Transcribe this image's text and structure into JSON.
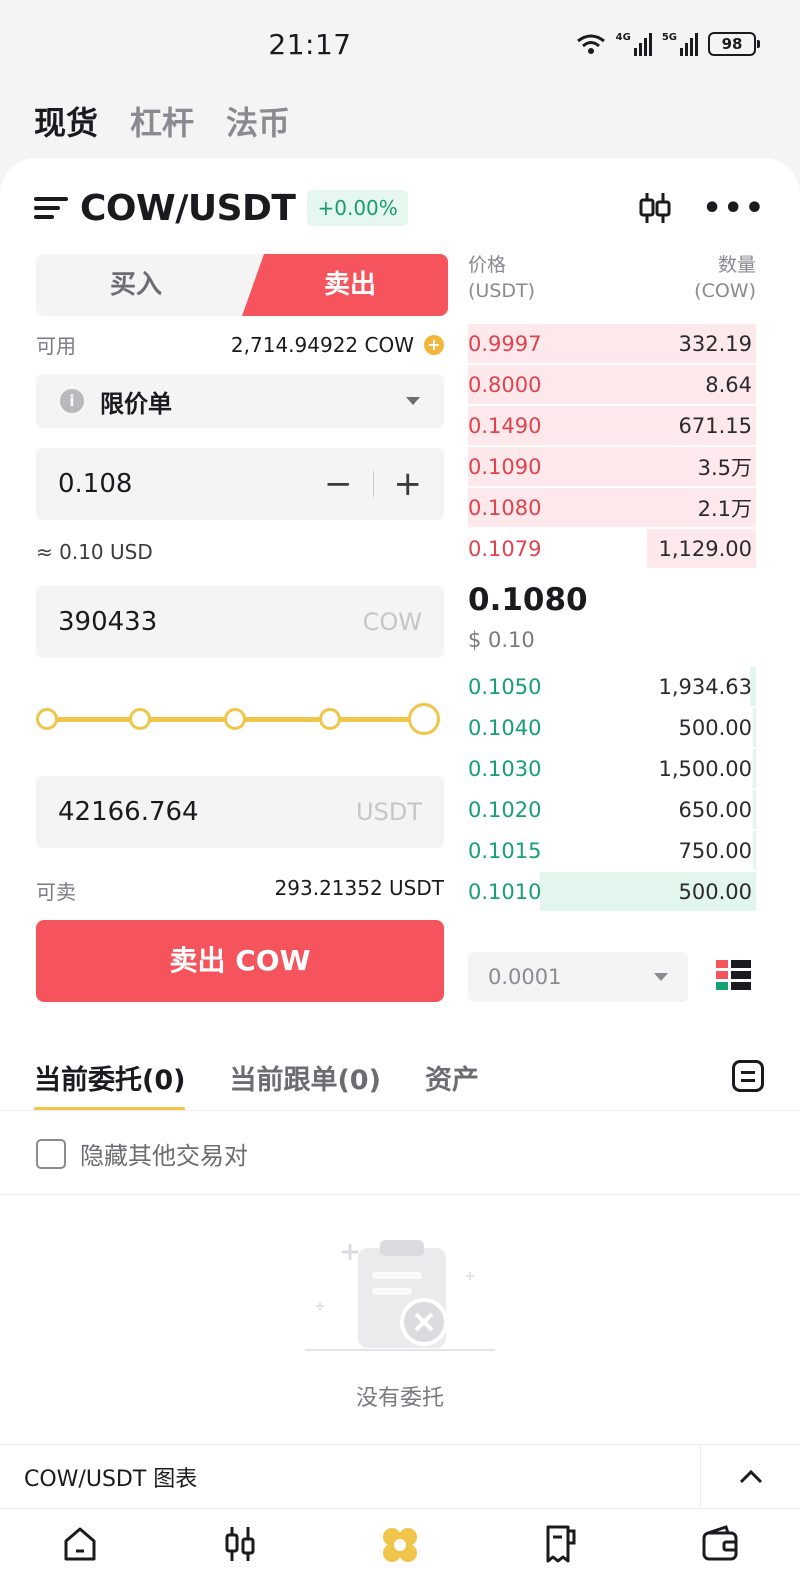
{
  "status_bar": {
    "time": "21:17",
    "network_4g": "4G",
    "network_5g": "5G",
    "battery": "98"
  },
  "market_tabs": [
    "现货",
    "杠杆",
    "法币"
  ],
  "pair": {
    "symbol": "COW/USDT",
    "change": "+0.00%"
  },
  "trade": {
    "buy_label": "买入",
    "sell_label": "卖出",
    "available_label": "可用",
    "available_value": "2,714.94922 COW",
    "order_type": "限价单",
    "price": "0.108",
    "approx_value": "≈ 0.10 USD",
    "amount": "390433",
    "amount_unit": "COW",
    "slider_percent": 100,
    "total": "42166.764",
    "total_unit": "USDT",
    "sellable_label": "可卖",
    "sellable_value": "293.21352 USDT",
    "submit_label": "卖出 COW"
  },
  "order_book": {
    "price_header": "价格",
    "price_unit": "(USDT)",
    "qty_header": "数量",
    "qty_unit": "(COW)",
    "asks": [
      {
        "price": "0.9997",
        "qty": "332.19",
        "depth": 1.0
      },
      {
        "price": "0.8000",
        "qty": "8.64",
        "depth": 1.0
      },
      {
        "price": "0.1490",
        "qty": "671.15",
        "depth": 1.0
      },
      {
        "price": "0.1090",
        "qty": "3.5万",
        "depth": 1.0
      },
      {
        "price": "0.1080",
        "qty": "2.1万",
        "depth": 1.0
      },
      {
        "price": "0.1079",
        "qty": "1,129.00",
        "depth": 0.38
      }
    ],
    "mid_price": "0.1080",
    "mid_usd": "$ 0.10",
    "bids": [
      {
        "price": "0.1050",
        "qty": "1,934.63",
        "depth": 0.02
      },
      {
        "price": "0.1040",
        "qty": "500.00",
        "depth": 0.01
      },
      {
        "price": "0.1030",
        "qty": "1,500.00",
        "depth": 0.01
      },
      {
        "price": "0.1020",
        "qty": "650.00",
        "depth": 0.01
      },
      {
        "price": "0.1015",
        "qty": "750.00",
        "depth": 0.01
      },
      {
        "price": "0.1010",
        "qty": "500.00",
        "depth": 0.75
      }
    ],
    "precision": "0.0001"
  },
  "orders": {
    "tabs": [
      "当前委托(0)",
      "当前跟单(0)",
      "资产"
    ],
    "hide_other_pairs": "隐藏其他交易对",
    "empty_text": "没有委托"
  },
  "chart_bar": {
    "label": "COW/USDT 图表"
  },
  "colors": {
    "sell": "#f5545d",
    "buy": "#17a074",
    "accent": "#f0c54a"
  }
}
